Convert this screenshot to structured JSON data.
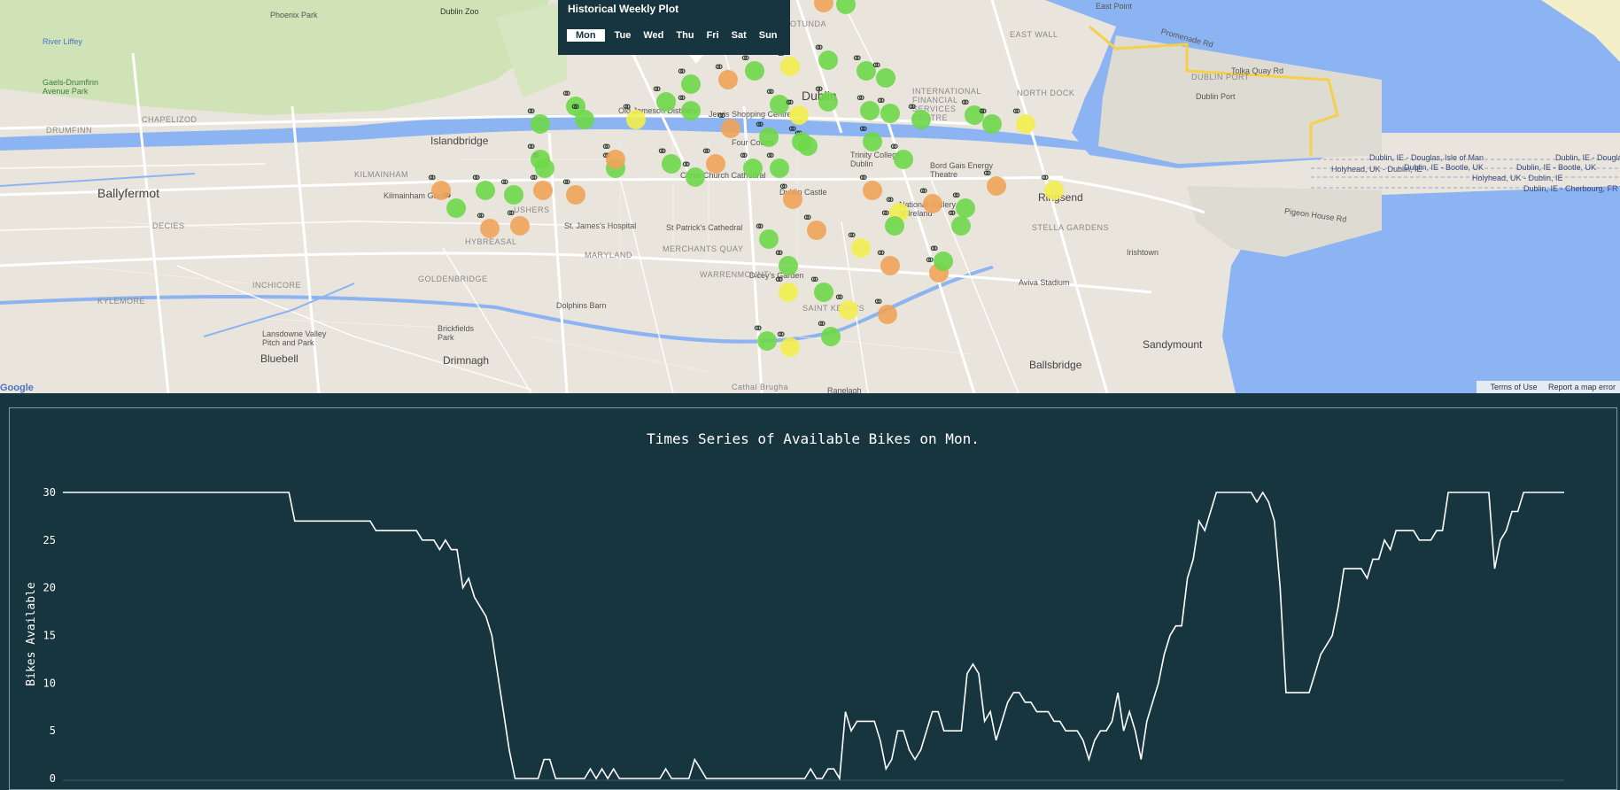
{
  "weekly_panel": {
    "title": "Historical Weekly Plot",
    "days": [
      "Mon",
      "Tue",
      "Wed",
      "Thu",
      "Fri",
      "Sat",
      "Sun"
    ],
    "selected": "Mon"
  },
  "map": {
    "labels": [
      "Phoenix Park",
      "Dublin Zoo",
      "River Liffey",
      "Gaels-Drumfinn Avenue Park",
      "DRUMFINN",
      "CHAPELIZOD",
      "Islandbridge",
      "KILMAINHAM",
      "Ballyfermot",
      "DECIES",
      "Kilmainham Gaol",
      "INCHICORE",
      "KYLEMORE",
      "GOLDENBRIDGE",
      "St. James's Hospital",
      "St Patrick's Cathedral",
      "Christ Church Cathedral",
      "Dublin Castle",
      "Four Courts",
      "Jervis Shopping Centre",
      "Old Jameson Distillery",
      "Dublin",
      "Trinity College Dublin",
      "Bord Gais Energy Theatre",
      "National Gallery of Ireland",
      "Ringsend",
      "Irishtown",
      "Aviva Stadium",
      "Sandymount",
      "Ballsbridge",
      "Dicey's Garden",
      "SAINT KEVIN'S",
      "Dolphins Barn",
      "Drimnagh",
      "Bluebell",
      "MERCHANTS QUAY",
      "WARRENMOUNT",
      "MARYLAND",
      "Dublin Port",
      "EAST WALL",
      "NORTH DOCK",
      "DUBLIN PORT",
      "ROTUNDA",
      "INTERNATIONAL FINANCIAL SERVICES CENTRE",
      "STELLA GARDENS",
      "Brickfields Park",
      "Lansdowne Valley Pitch and Park",
      "Cathal Brugha",
      "Ranelagh",
      "USHERS",
      "HYBREASAL"
    ],
    "shipping_labels": [
      "Dublin, IE - Douglas, Isle of Man",
      "Dublin, IE - Bootle, UK",
      "Holyhead, UK - Dublin, IE",
      "Dublin, IE - Cherbourg, FR"
    ],
    "roads": [
      "Promenade Rd",
      "Tolka Quay Rd",
      "Pigeon House Rd",
      "East Point"
    ],
    "footer": {
      "terms": "Terms of Use",
      "report": "Report a map error",
      "google": "Google"
    }
  },
  "chart_data": {
    "type": "line",
    "title": "Times Series of Available Bikes on Mon.",
    "xlabel": "",
    "ylabel": "Bikes Available",
    "ylim": [
      0,
      30
    ],
    "yticks": [
      0,
      5,
      10,
      15,
      20,
      25,
      30
    ],
    "grid": false,
    "series": [
      {
        "values": [
          30,
          30,
          30,
          30,
          30,
          30,
          30,
          30,
          30,
          30,
          30,
          30,
          30,
          30,
          30,
          30,
          30,
          30,
          30,
          30,
          30,
          30,
          30,
          30,
          30,
          30,
          30,
          30,
          30,
          30,
          30,
          30,
          30,
          30,
          30,
          30,
          30,
          30,
          30,
          30,
          27,
          27,
          27,
          27,
          27,
          27,
          27,
          27,
          27,
          27,
          27,
          27,
          27,
          27,
          26,
          26,
          26,
          26,
          26,
          26,
          26,
          26,
          25,
          25,
          25,
          24,
          25,
          24,
          24,
          20,
          21,
          19,
          18,
          17,
          15,
          11,
          7,
          3,
          0,
          0,
          0,
          0,
          0,
          2,
          2,
          0,
          0,
          0,
          0,
          0,
          0,
          1,
          0,
          1,
          0,
          1,
          0,
          0,
          0,
          0,
          0,
          0,
          0,
          0,
          1,
          0,
          0,
          0,
          0,
          2,
          1,
          0,
          0,
          0,
          0,
          0,
          0,
          0,
          0,
          0,
          0,
          0,
          0,
          0,
          0,
          0,
          0,
          0,
          0,
          1,
          0,
          0,
          1,
          1,
          0,
          7,
          5,
          6,
          6,
          6,
          6,
          4,
          1,
          2,
          5,
          5,
          3,
          2,
          3,
          5,
          7,
          7,
          5,
          5,
          5,
          5,
          11,
          12,
          11,
          6,
          7,
          4,
          6,
          8,
          9,
          9,
          8,
          8,
          7,
          7,
          7,
          6,
          6,
          5,
          5,
          5,
          4,
          2,
          4,
          5,
          5,
          6,
          9,
          5,
          7,
          5,
          2,
          6,
          8,
          10,
          13,
          15,
          16,
          16,
          21,
          23,
          27,
          26,
          28,
          30,
          30,
          30,
          30,
          30,
          30,
          30,
          29,
          30,
          29,
          27,
          20,
          9,
          9,
          9,
          9,
          9,
          11,
          13,
          14,
          15,
          18,
          22,
          22,
          22,
          22,
          21,
          23,
          23,
          25,
          24,
          26,
          26,
          26,
          26,
          25,
          25,
          25,
          26,
          26,
          30,
          30,
          30,
          30,
          30,
          30,
          30,
          30,
          22,
          25,
          26,
          28,
          28,
          30,
          30,
          30,
          30,
          30,
          30,
          30,
          30
        ]
      }
    ]
  },
  "colors": {
    "panel_bg": "#17353f",
    "line": "#ffffff",
    "station_green": "#6fd84a",
    "station_yellow": "#f2ee4f",
    "station_orange": "#f0a45a",
    "water": "#8db4f2"
  }
}
